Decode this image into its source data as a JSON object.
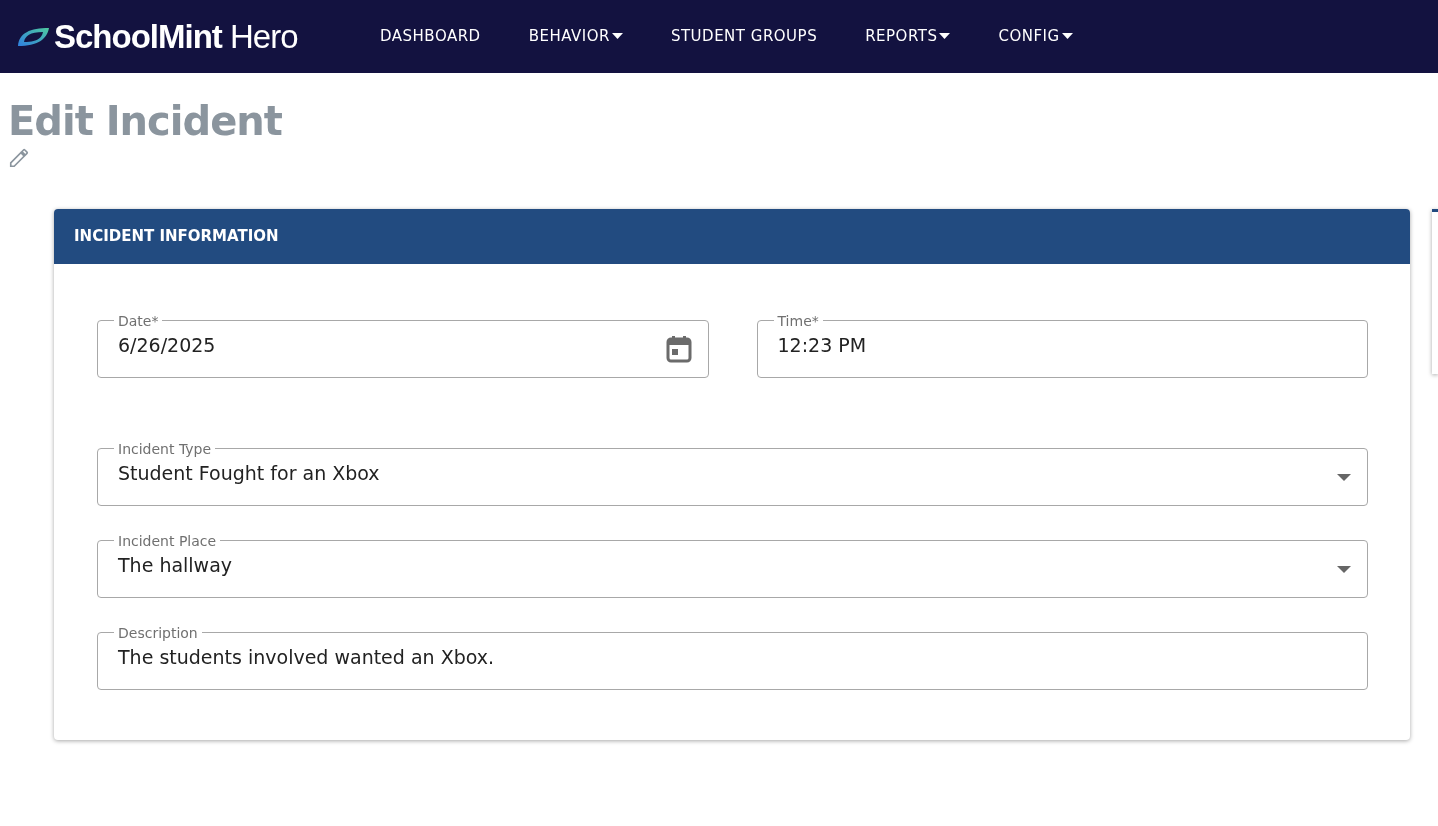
{
  "brand": {
    "name": "SchoolMint",
    "suffix": "Hero"
  },
  "nav": [
    {
      "label": "DASHBOARD",
      "dropdown": false
    },
    {
      "label": "BEHAVIOR",
      "dropdown": true
    },
    {
      "label": "STUDENT GROUPS",
      "dropdown": false
    },
    {
      "label": "REPORTS",
      "dropdown": true
    },
    {
      "label": "CONFIG",
      "dropdown": true
    }
  ],
  "page_title": "Edit Incident",
  "card": {
    "title": "INCIDENT INFORMATION",
    "fields": [
      {
        "kind": "date",
        "label": "Date*",
        "value": "6/26/2025"
      },
      {
        "kind": "time",
        "label": "Time*",
        "value": "12:23 PM"
      },
      {
        "kind": "select",
        "label": "Incident Type",
        "value": "Student Fought for an Xbox"
      },
      {
        "kind": "select",
        "label": "Incident Place",
        "value": "The hallway"
      },
      {
        "kind": "text",
        "label": "Description",
        "value": "The students involved wanted an Xbox."
      }
    ]
  }
}
